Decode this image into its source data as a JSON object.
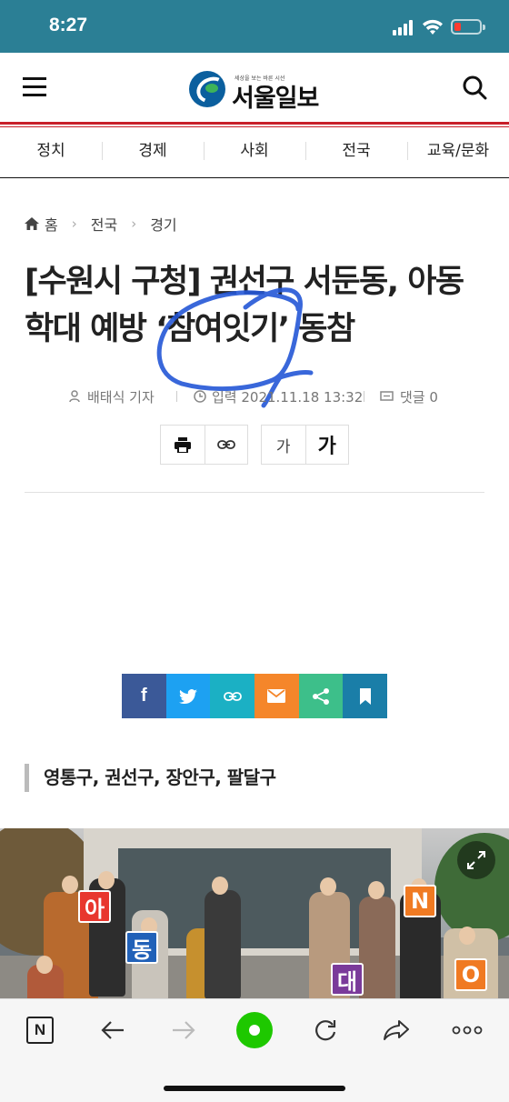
{
  "status_bar": {
    "time": "8:27",
    "icons": [
      "cellular-signal-icon",
      "wifi-icon",
      "battery-low-icon"
    ],
    "battery_color": "#ff3b30",
    "background": "#2b7f95"
  },
  "header": {
    "logo_text": "서울일보",
    "logo_slogan": "세상을 보는 바른 시선",
    "menu_icon": "hamburger-icon",
    "search_icon": "search-icon",
    "accent": "#c8202a"
  },
  "nav": {
    "items": [
      {
        "label": "정치"
      },
      {
        "label": "경제"
      },
      {
        "label": "사회"
      },
      {
        "label": "전국"
      },
      {
        "label": "교육/문화"
      }
    ]
  },
  "breadcrumb": {
    "home": "홈",
    "level1": "전국",
    "level2": "경기"
  },
  "article": {
    "title_line1": "[수원시 구청] 권선구 서둔동, 아동",
    "title_line2": "학대 예방 ‘참여잇기’ 동참",
    "author": "배태식 기자",
    "date": "입력 2021.11.18 13:32",
    "comments": "댓글 0",
    "subtitle": "영통구, 권선구, 장안구, 팔달구"
  },
  "tools": {
    "print_icon": "print-icon",
    "link_icon": "link-icon",
    "font_small": "가",
    "font_large": "가"
  },
  "share": {
    "buttons": [
      {
        "name": "facebook",
        "label": "f",
        "color": "#3b5998"
      },
      {
        "name": "twitter",
        "label": "twitter-icon",
        "color": "#1da1f2"
      },
      {
        "name": "link",
        "label": "link-icon",
        "color": "#1bb0c4"
      },
      {
        "name": "email",
        "label": "email-icon",
        "color": "#f5862a"
      },
      {
        "name": "share",
        "label": "share-icon",
        "color": "#3dbf8a"
      },
      {
        "name": "bookmark",
        "label": "bookmark-icon",
        "color": "#1a7ea8"
      }
    ]
  },
  "photo": {
    "sign_letters": [
      "아",
      "동",
      "대",
      "N",
      "O"
    ],
    "sign_colors": [
      "#e8372e",
      "#2161b8",
      "#7a3a9a",
      "#f07a22",
      "#f07a22"
    ]
  },
  "browser_toolbar": {
    "icons": [
      "naver-n-icon",
      "back-arrow-icon",
      "forward-arrow-icon",
      "green-dot-icon",
      "reload-icon",
      "share-arrow-icon",
      "more-icon"
    ],
    "naver_letter": "N",
    "green": "#1ec800"
  }
}
